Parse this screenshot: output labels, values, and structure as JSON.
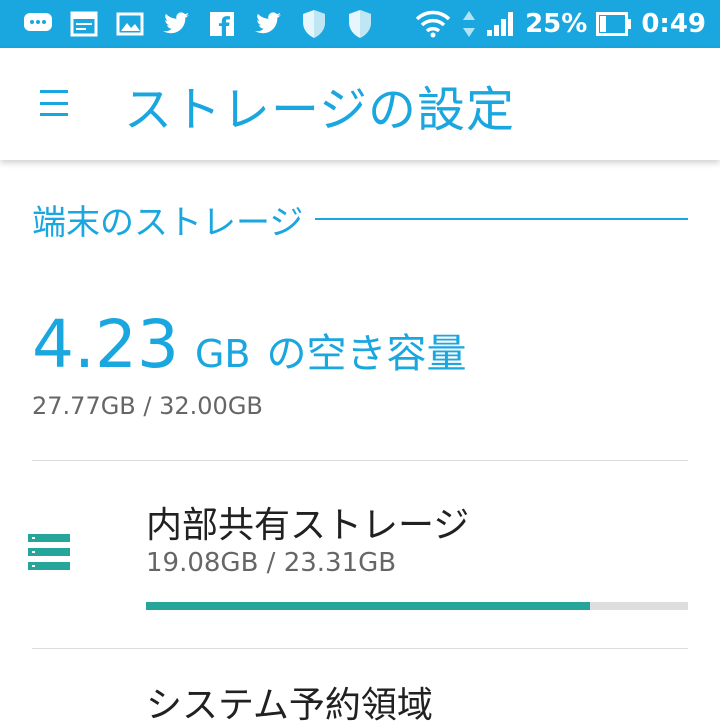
{
  "status_bar": {
    "notification_icons": [
      "chat-bubble-icon",
      "calendar-icon",
      "image-icon",
      "twitter-icon",
      "facebook-icon",
      "twitter-icon",
      "shield-icon",
      "shield-icon"
    ],
    "battery_percent": "25%",
    "time": "0:49",
    "battery_level": 0.25
  },
  "app_bar": {
    "title": "ストレージの設定"
  },
  "section": {
    "title": "端末のストレージ"
  },
  "summary": {
    "free_number": "4.23",
    "free_unit": "GB",
    "free_suffix": "の空き容量",
    "used_total": "27.77GB / 32.00GB"
  },
  "storage_items": [
    {
      "title": "内部共有ストレージ",
      "usage": "19.08GB / 23.31GB",
      "used_fraction": 0.8186
    }
  ],
  "next_item": {
    "title": "システム予約領域"
  },
  "colors": {
    "accent": "#1aa6df",
    "storage_bar": "#26a69a",
    "bar_track": "#dedede"
  }
}
